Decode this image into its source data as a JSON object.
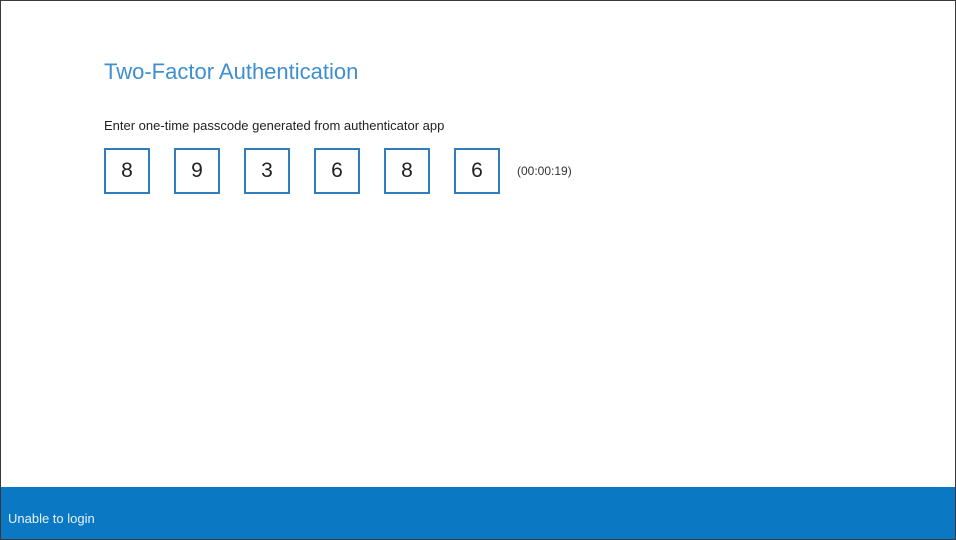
{
  "page": {
    "title": "Two-Factor Authentication",
    "instruction": "Enter one-time passcode generated from authenticator app"
  },
  "passcode": {
    "digits": [
      "8",
      "9",
      "3",
      "6",
      "8",
      "6"
    ],
    "timer": "(00:00:19)"
  },
  "footer": {
    "link_label": "Unable to login"
  },
  "colors": {
    "title": "#3f8fd0",
    "box_border": "#2f7dbd",
    "footer_bg": "#0a78c2"
  }
}
